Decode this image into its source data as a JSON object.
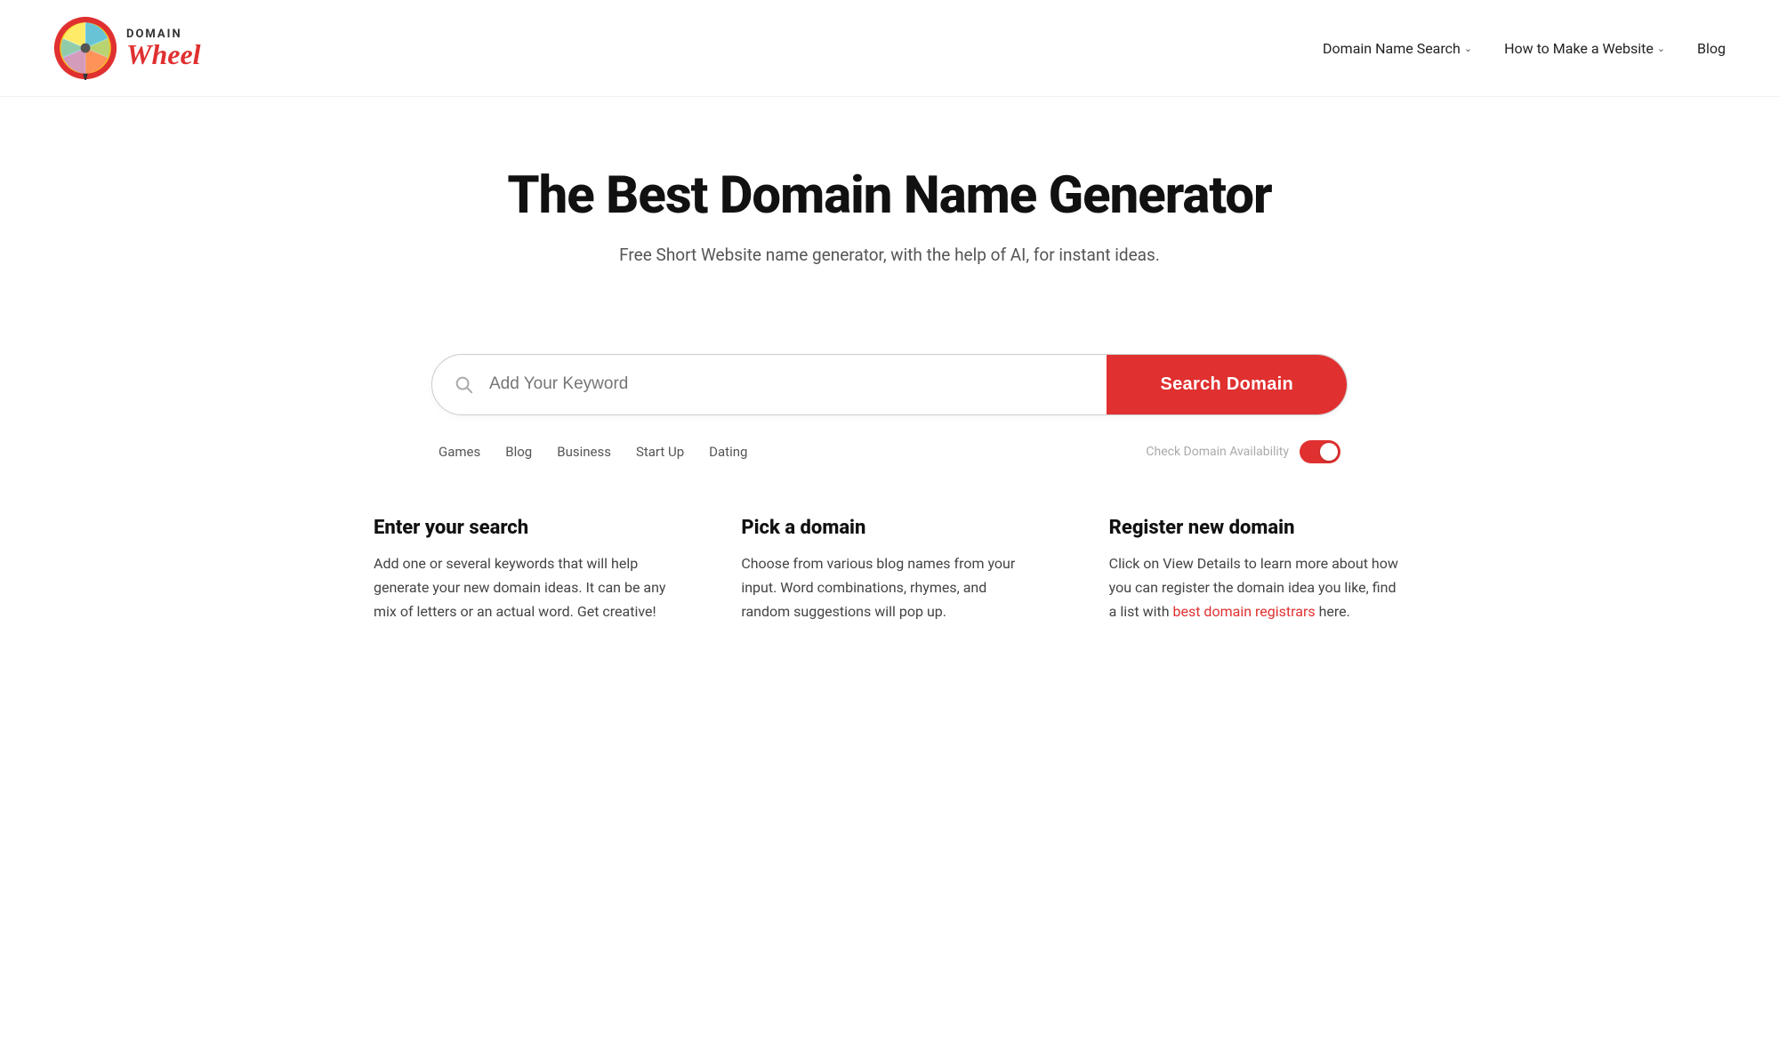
{
  "header": {
    "logo_domain": "DOMAIN",
    "logo_wheel": "Wheel",
    "nav": [
      {
        "label": "Domain Name Search",
        "has_dropdown": true
      },
      {
        "label": "How to Make a Website",
        "has_dropdown": true
      },
      {
        "label": "Blog",
        "has_dropdown": false
      }
    ]
  },
  "hero": {
    "title": "The Best Domain Name Generator",
    "subtitle": "Free Short Website name generator, with the help of AI, for instant ideas."
  },
  "search": {
    "placeholder": "Add Your Keyword",
    "button_label": "Search Domain",
    "tags": [
      "Games",
      "Blog",
      "Business",
      "Start Up",
      "Dating"
    ],
    "check_domain_label": "Check Domain Availability"
  },
  "info_columns": [
    {
      "id": "enter-search",
      "heading": "Enter your search",
      "body": "Add one or several keywords that will help generate your new domain ideas. It can be any mix of letters or an actual word. Get creative!"
    },
    {
      "id": "pick-domain",
      "heading": "Pick a domain",
      "body": "Choose from various blog names from your input. Word combinations, rhymes, and random suggestions will pop up."
    },
    {
      "id": "register-domain",
      "heading": "Register new domain",
      "body_parts": [
        "Click on View Details to learn more about how you can register the domain idea you like, find a list with ",
        "best domain registrars",
        " here."
      ]
    }
  ],
  "colors": {
    "accent": "#e03030",
    "text_primary": "#111111",
    "text_secondary": "#555555",
    "text_muted": "#aaaaaa"
  }
}
